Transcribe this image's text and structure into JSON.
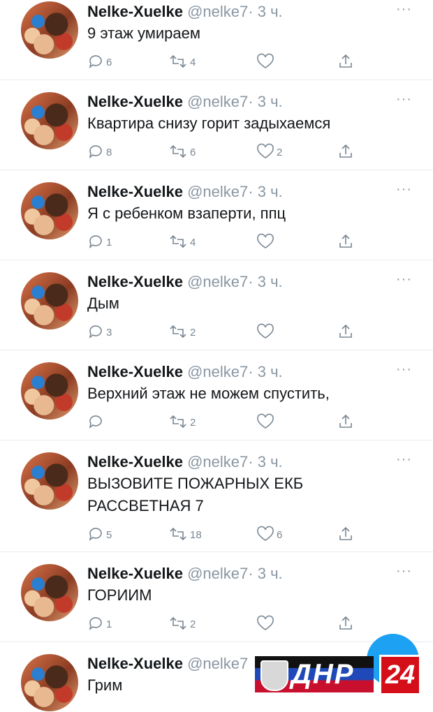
{
  "tweets": [
    {
      "name": "Nelke-Xuelke",
      "handle": "@nelke7",
      "dot": "·",
      "time": "3 ч.",
      "text": "9 этаж умираем",
      "replies": "6",
      "retweets": "4",
      "likes": ""
    },
    {
      "name": "Nelke-Xuelke",
      "handle": "@nelke7",
      "dot": "·",
      "time": "3 ч.",
      "text": "Квартира снизу горит задыхаемся",
      "replies": "8",
      "retweets": "6",
      "likes": "2"
    },
    {
      "name": "Nelke-Xuelke",
      "handle": "@nelke7",
      "dot": "·",
      "time": "3 ч.",
      "text": "Я с ребенком взаперти, ппц",
      "replies": "1",
      "retweets": "4",
      "likes": ""
    },
    {
      "name": "Nelke-Xuelke",
      "handle": "@nelke7",
      "dot": "·",
      "time": "3 ч.",
      "text": "Дым",
      "replies": "3",
      "retweets": "2",
      "likes": ""
    },
    {
      "name": "Nelke-Xuelke",
      "handle": "@nelke7",
      "dot": "·",
      "time": "3 ч.",
      "text": "Верхний этаж не можем спустить,",
      "replies": "",
      "retweets": "2",
      "likes": ""
    },
    {
      "name": "Nelke-Xuelke",
      "handle": "@nelke7",
      "dot": "·",
      "time": "3 ч.",
      "text": "ВЫЗОВИТЕ ПОЖАРНЫХ ЕКБ\nРАССВЕТНАЯ 7",
      "replies": "5",
      "retweets": "18",
      "likes": "6"
    },
    {
      "name": "Nelke-Xuelke",
      "handle": "@nelke7",
      "dot": "·",
      "time": "3 ч.",
      "text": "ГОРИИМ",
      "replies": "1",
      "retweets": "2",
      "likes": ""
    },
    {
      "name": "Nelke-Xuelke",
      "handle": "@nelke7",
      "dot": "",
      "time": "",
      "text": "Грим",
      "replies": "",
      "retweets": "",
      "likes": ""
    }
  ],
  "more_label": "···",
  "icons": {
    "reply": "reply-icon",
    "retweet": "retweet-icon",
    "like": "heart-icon",
    "share": "share-icon",
    "compose": "compose-button"
  },
  "watermark": {
    "word": "ДНР",
    "number": "24"
  },
  "colors": {
    "accent": "#1da1f2",
    "muted": "#8a97a3",
    "border": "#e6ecf0",
    "logo_red": "#d40f1a"
  }
}
